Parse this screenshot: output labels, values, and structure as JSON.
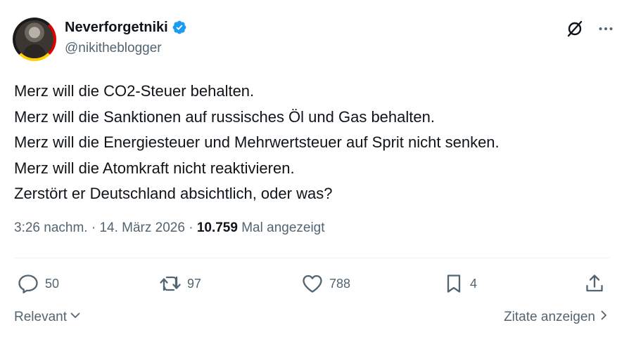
{
  "author": {
    "display_name": "Neverforgetniki",
    "handle": "@nikitheblogger",
    "verified": true
  },
  "icons": {
    "top_right": [
      "grok-slash-icon",
      "more-icon"
    ],
    "actions": [
      "reply-icon",
      "retweet-icon",
      "like-icon",
      "bookmark-icon",
      "share-icon"
    ]
  },
  "tweet": {
    "lines": [
      "Merz will die CO2-Steuer behalten.",
      "Merz will die Sanktionen auf russisches Öl und Gas behalten.",
      "Merz will die Energiesteuer und Mehrwertsteuer auf Sprit nicht senken.",
      "Merz will die Atomkraft nicht reaktivieren.",
      "Zerstört er Deutschland absichtlich, oder was?"
    ]
  },
  "meta": {
    "time": "3:26 nachm.",
    "separator": "·",
    "date": "14. März 2026",
    "views_count": "10.759",
    "views_label": "Mal angezeigt"
  },
  "actions": {
    "replies": "50",
    "retweets": "97",
    "likes": "788",
    "bookmarks": "4"
  },
  "footer": {
    "sort_label": "Relevant",
    "quotes_label": "Zitate anzeigen"
  },
  "colors": {
    "text": "#0f1419",
    "secondary": "#536471",
    "verified_blue": "#1d9bf0",
    "divider": "#eff3f4"
  }
}
